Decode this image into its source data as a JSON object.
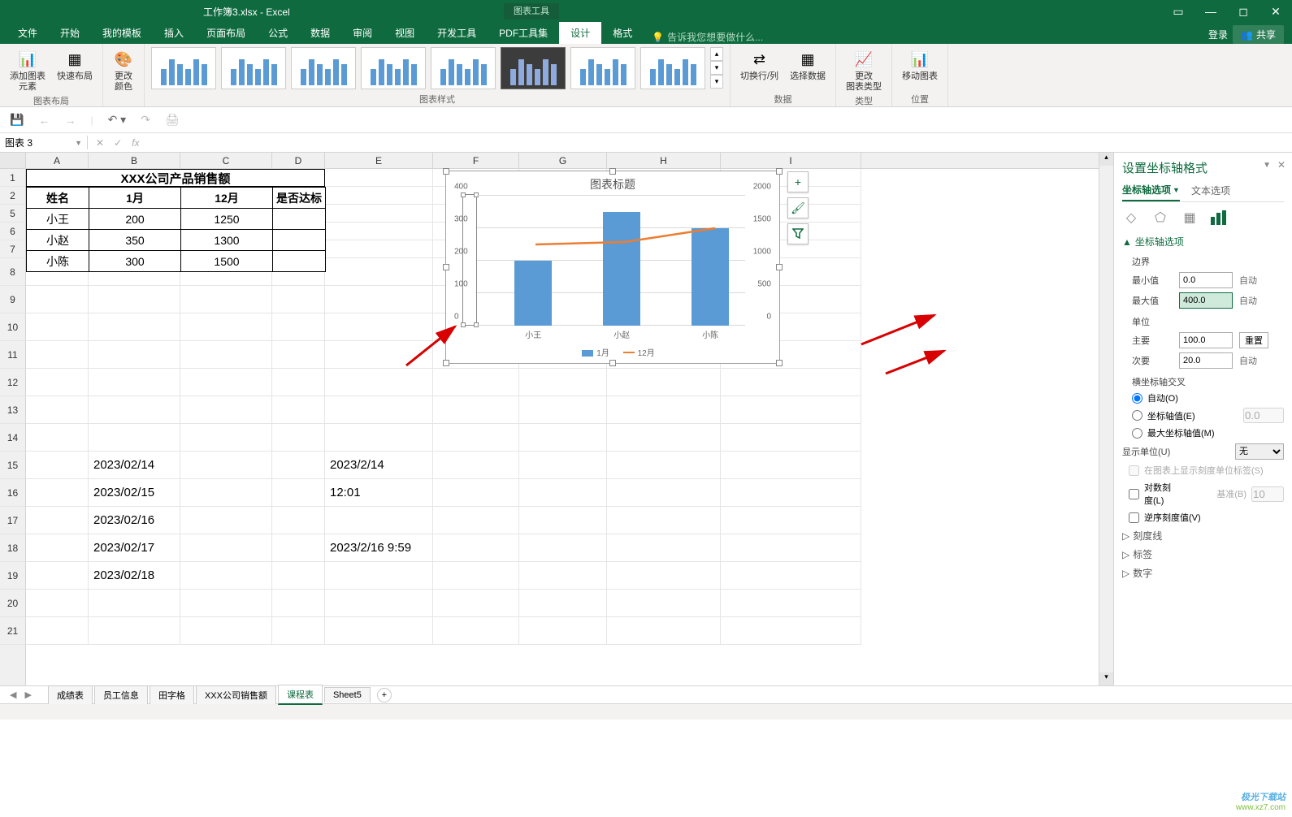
{
  "title": {
    "doc": "工作簿3.xlsx - Excel",
    "chart_tools": "图表工具",
    "login": "登录",
    "share": "共享"
  },
  "ribbon_tabs": [
    "文件",
    "开始",
    "我的模板",
    "插入",
    "页面布局",
    "公式",
    "数据",
    "审阅",
    "视图",
    "开发工具",
    "PDF工具集",
    "设计",
    "格式"
  ],
  "tell_me": "告诉我您想要做什么...",
  "ribbon_groups": {
    "layout": {
      "add_element": "添加图表\n元素",
      "quick_layout": "快速布局",
      "label": "图表布局"
    },
    "colors": {
      "change_colors": "更改\n颜色"
    },
    "styles_label": "图表样式",
    "data": {
      "switch": "切换行/列",
      "select": "选择数据",
      "label": "数据"
    },
    "type": {
      "change_type": "更改\n图表类型",
      "label": "类型"
    },
    "location": {
      "move": "移动图表",
      "label": "位置"
    }
  },
  "name_box": "图表 3",
  "columns": [
    "A",
    "B",
    "C",
    "D",
    "E",
    "F",
    "G",
    "H",
    "I"
  ],
  "rows": [
    1,
    2,
    5,
    6,
    7,
    8,
    9,
    10,
    11,
    12,
    13,
    14,
    15,
    16,
    17,
    18,
    19,
    20,
    21
  ],
  "table": {
    "title": "XXX公司产品销售额",
    "headers": [
      "姓名",
      "1月",
      "12月",
      "是否达标"
    ],
    "rows": [
      {
        "name": "小王",
        "m1": "200",
        "m12": "1250",
        "ok": ""
      },
      {
        "name": "小赵",
        "m1": "350",
        "m12": "1300",
        "ok": ""
      },
      {
        "name": "小陈",
        "m1": "300",
        "m12": "1500",
        "ok": ""
      }
    ]
  },
  "dates_b": [
    "2023/02/14",
    "2023/02/15",
    "2023/02/16",
    "2023/02/17",
    "2023/02/18"
  ],
  "dates_e": {
    "r15": "2023/2/14",
    "r16": "12:01",
    "r18": "2023/2/16 9:59"
  },
  "chart": {
    "title": "图表标题",
    "y_left": [
      "0",
      "100",
      "200",
      "300",
      "400"
    ],
    "y_right": [
      "0",
      "500",
      "1000",
      "1500",
      "2000"
    ],
    "categories": [
      "小王",
      "小赵",
      "小陈"
    ],
    "legend": {
      "s1": "1月",
      "s2": "12月"
    },
    "side_buttons": [
      "+",
      "brush",
      "filter"
    ]
  },
  "chart_data": {
    "type": "bar+line",
    "categories": [
      "小王",
      "小赵",
      "小陈"
    ],
    "series": [
      {
        "name": "1月",
        "type": "bar",
        "axis": "left",
        "values": [
          200,
          350,
          300
        ]
      },
      {
        "name": "12月",
        "type": "line",
        "axis": "right",
        "values": [
          1250,
          1300,
          1500
        ]
      }
    ],
    "title": "图表标题",
    "y_left": {
      "min": 0,
      "max": 400,
      "unit": 100
    },
    "y_right": {
      "min": 0,
      "max": 2000,
      "unit": 500
    }
  },
  "format_pane": {
    "title": "设置坐标轴格式",
    "tab_axis": "坐标轴选项",
    "tab_text": "文本选项",
    "section_axis_options": "坐标轴选项",
    "bounds": "边界",
    "min_label": "最小值",
    "min_val": "0.0",
    "min_auto": "自动",
    "max_label": "最大值",
    "max_val": "400.0",
    "max_auto": "自动",
    "unit": "单位",
    "major_label": "主要",
    "major_val": "100.0",
    "reset": "重置",
    "minor_label": "次要",
    "minor_val": "20.0",
    "minor_auto": "自动",
    "cross_label": "横坐标轴交叉",
    "cross_auto": "自动(O)",
    "cross_value": "坐标轴值(E)",
    "cross_value_val": "0.0",
    "cross_max": "最大坐标轴值(M)",
    "display_unit_label": "显示单位(U)",
    "display_unit_val": "无",
    "show_unit_label": "在图表上显示刻度单位标签(S)",
    "log_label": "对数刻度(L)",
    "log_base_label": "基准(B)",
    "log_base": "10",
    "reverse": "逆序刻度值(V)",
    "sec_ticks": "刻度线",
    "sec_labels": "标签",
    "sec_numbers": "数字"
  },
  "sheet_tabs": [
    "成绩表",
    "员工信息",
    "田字格",
    "XXX公司销售额",
    "课程表",
    "Sheet5"
  ],
  "watermark": {
    "line1": "极光下载站",
    "line2": "www.xz7.com"
  }
}
